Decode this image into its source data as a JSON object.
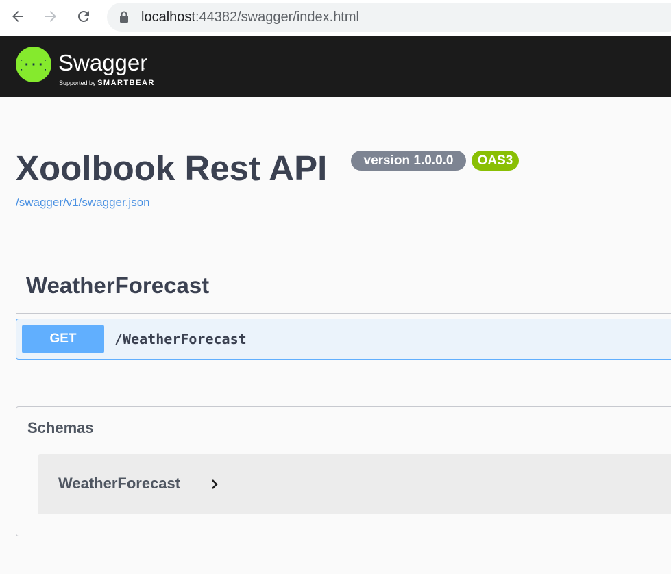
{
  "browser": {
    "url_host": "localhost",
    "url_rest": ":44382/swagger/index.html"
  },
  "topbar": {
    "logo_text": "Swagger",
    "logo_tm": "™",
    "supported_by": "Supported by",
    "smartbear": "SMARTBEAR",
    "logo_color": "#85ea2d"
  },
  "info": {
    "title": "Xoolbook Rest API",
    "version_badge": "version 1.0.0.0",
    "oas_badge": "OAS3",
    "spec_link": "/swagger/v1/swagger.json"
  },
  "tag": {
    "name": "WeatherForecast",
    "operations": [
      {
        "method": "GET",
        "path": "/WeatherForecast",
        "color": "#61affe"
      }
    ]
  },
  "schemas": {
    "title": "Schemas",
    "models": [
      {
        "name": "WeatherForecast"
      }
    ]
  }
}
